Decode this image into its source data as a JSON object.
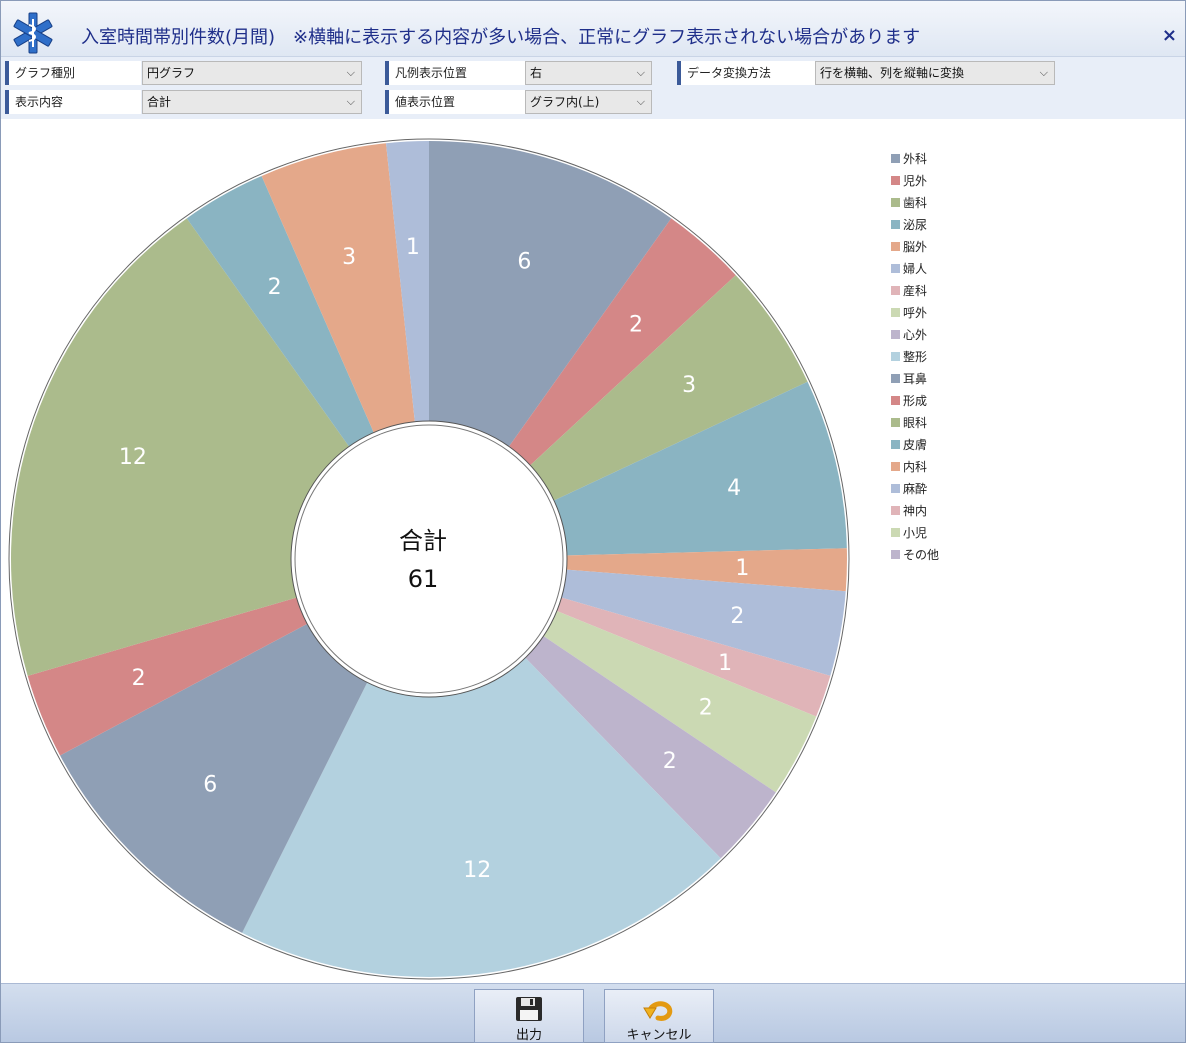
{
  "window": {
    "title": "入室時間帯別件数(月間)　※横軸に表示する内容が多い場合、正常にグラフ表示されない場合があります",
    "close_label": "×"
  },
  "controls": {
    "graph_type": {
      "label": "グラフ種別",
      "value": "円グラフ"
    },
    "legend_pos": {
      "label": "凡例表示位置",
      "value": "右"
    },
    "data_transform": {
      "label": "データ変換方法",
      "value": "行を横軸、列を縦軸に変換"
    },
    "display_content": {
      "label": "表示内容",
      "value": "合計"
    },
    "value_pos": {
      "label": "値表示位置",
      "value": "グラフ内(上)"
    }
  },
  "chart_data": {
    "type": "pie",
    "center_label": "合計",
    "center_value": "61",
    "categories": [
      "外科",
      "児外",
      "歯科",
      "泌尿",
      "脳外",
      "婦人",
      "産科",
      "呼外",
      "心外",
      "整形",
      "耳鼻",
      "形成",
      "眼科",
      "皮膚",
      "内科",
      "麻酔",
      "神内",
      "小児",
      "その他"
    ],
    "values": [
      6,
      2,
      3,
      4,
      1,
      2,
      1,
      2,
      2,
      12,
      6,
      2,
      12,
      2,
      3,
      1,
      0,
      0,
      0
    ],
    "colors": [
      "#8f9fb5",
      "#d48787",
      "#abbb8c",
      "#8ab4c2",
      "#e4a88a",
      "#aebdd9",
      "#e0b4b8",
      "#cbd9b3",
      "#bdb4cc",
      "#b3d1df",
      "#8f9fb5",
      "#d48787",
      "#abbb8c",
      "#8ab4c2",
      "#e4a88a",
      "#aebdd9",
      "#e0b4b8",
      "#cbd9b3",
      "#bdb4cc"
    ],
    "legend_position": "right"
  },
  "footer": {
    "output_label": "出力",
    "cancel_label": "キャンセル"
  }
}
